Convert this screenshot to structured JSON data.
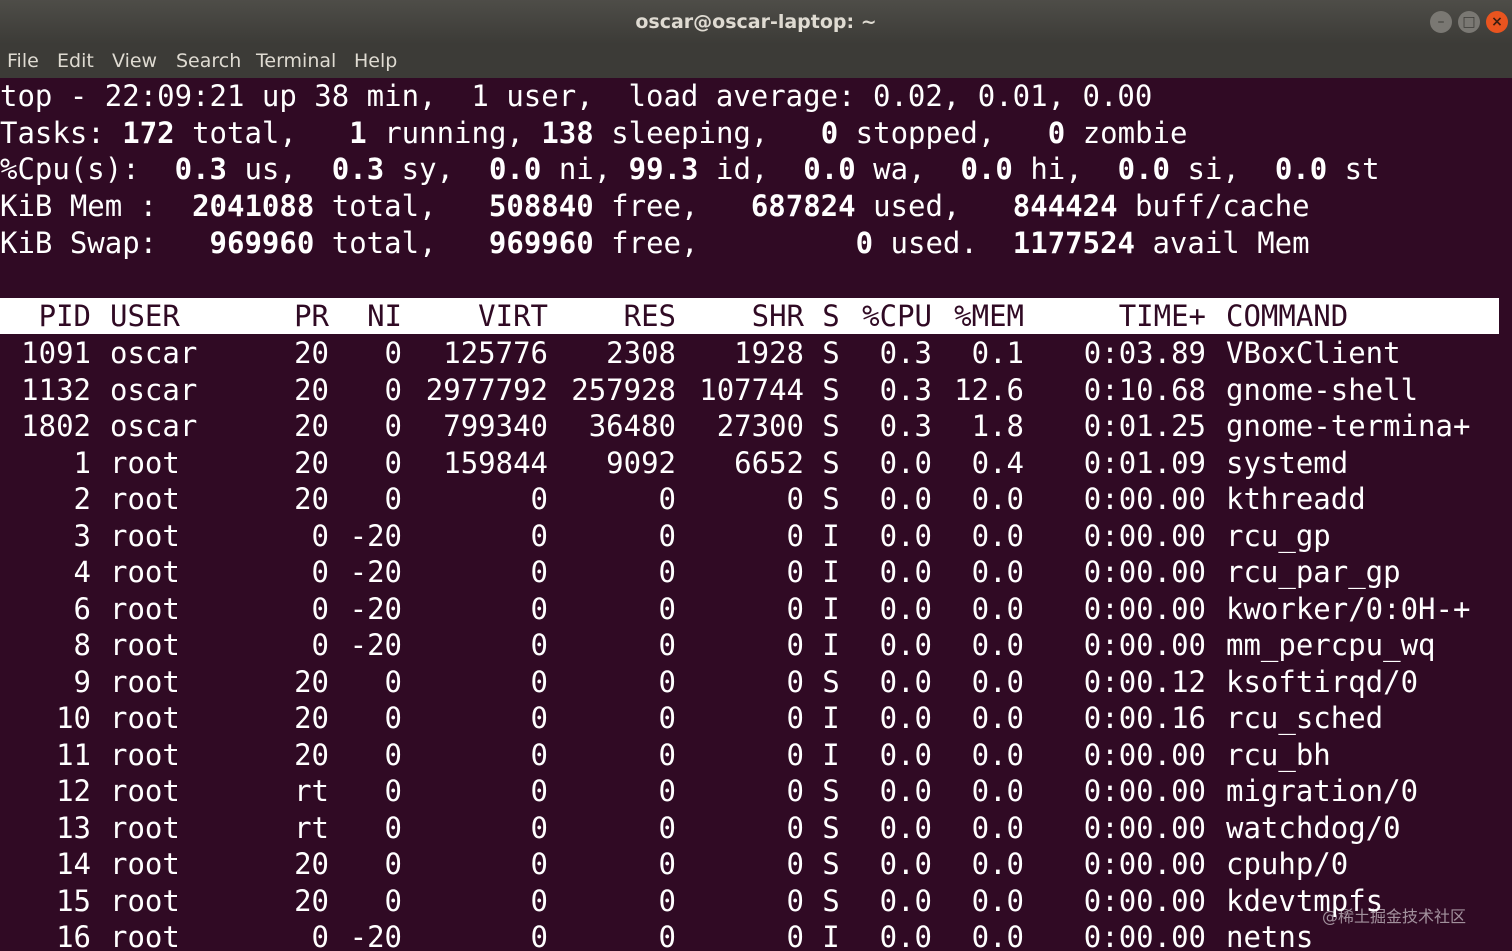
{
  "window": {
    "title": "oscar@oscar-laptop: ~"
  },
  "controls": {
    "minimize": "–",
    "maximize": "□",
    "close": "×"
  },
  "menu": [
    "File",
    "Edit",
    "View",
    "Search",
    "Terminal",
    "Help"
  ],
  "summary": {
    "line1": "top - 22:09:21 up 38 min,  1 user,  load average: 0.02, 0.01, 0.00",
    "tasks": {
      "label": "Tasks:",
      "total": "172",
      "total_label": "total,",
      "running": "1",
      "running_label": "running,",
      "sleeping": "138",
      "sleeping_label": "sleeping,",
      "stopped": "0",
      "stopped_label": "stopped,",
      "zombie": "0",
      "zombie_label": "zombie"
    },
    "cpu": {
      "label": "%Cpu(s):",
      "us": "0.3",
      "us_label": "us,",
      "sy": "0.3",
      "sy_label": "sy,",
      "ni": "0.0",
      "ni_label": "ni,",
      "id": "99.3",
      "id_label": "id,",
      "wa": "0.0",
      "wa_label": "wa,",
      "hi": "0.0",
      "hi_label": "hi,",
      "si": "0.0",
      "si_label": "si,",
      "st": "0.0",
      "st_label": "st"
    },
    "mem": {
      "label": "KiB Mem :",
      "total": "2041088",
      "total_label": "total,",
      "free": "508840",
      "free_label": "free,",
      "used": "687824",
      "used_label": "used,",
      "buff": "844424",
      "buff_label": "buff/cache"
    },
    "swap": {
      "label": "KiB Swap:",
      "total": "969960",
      "total_label": "total,",
      "free": "969960",
      "free_label": "free,",
      "used": "0",
      "used_label": "used.",
      "avail": "1177524",
      "avail_label": "avail Mem"
    }
  },
  "columns": [
    "PID",
    "USER",
    "PR",
    "NI",
    "VIRT",
    "RES",
    "SHR",
    "S",
    "%CPU",
    "%MEM",
    "TIME+",
    "COMMAND"
  ],
  "processes": [
    [
      "1091",
      "oscar",
      "20",
      "0",
      "125776",
      "2308",
      "1928",
      "S",
      "0.3",
      "0.1",
      "0:03.89",
      "VBoxClient"
    ],
    [
      "1132",
      "oscar",
      "20",
      "0",
      "2977792",
      "257928",
      "107744",
      "S",
      "0.3",
      "12.6",
      "0:10.68",
      "gnome-shell"
    ],
    [
      "1802",
      "oscar",
      "20",
      "0",
      "799340",
      "36480",
      "27300",
      "S",
      "0.3",
      "1.8",
      "0:01.25",
      "gnome-termina+"
    ],
    [
      "1",
      "root",
      "20",
      "0",
      "159844",
      "9092",
      "6652",
      "S",
      "0.0",
      "0.4",
      "0:01.09",
      "systemd"
    ],
    [
      "2",
      "root",
      "20",
      "0",
      "0",
      "0",
      "0",
      "S",
      "0.0",
      "0.0",
      "0:00.00",
      "kthreadd"
    ],
    [
      "3",
      "root",
      "0",
      "-20",
      "0",
      "0",
      "0",
      "I",
      "0.0",
      "0.0",
      "0:00.00",
      "rcu_gp"
    ],
    [
      "4",
      "root",
      "0",
      "-20",
      "0",
      "0",
      "0",
      "I",
      "0.0",
      "0.0",
      "0:00.00",
      "rcu_par_gp"
    ],
    [
      "6",
      "root",
      "0",
      "-20",
      "0",
      "0",
      "0",
      "I",
      "0.0",
      "0.0",
      "0:00.00",
      "kworker/0:0H-+"
    ],
    [
      "8",
      "root",
      "0",
      "-20",
      "0",
      "0",
      "0",
      "I",
      "0.0",
      "0.0",
      "0:00.00",
      "mm_percpu_wq"
    ],
    [
      "9",
      "root",
      "20",
      "0",
      "0",
      "0",
      "0",
      "S",
      "0.0",
      "0.0",
      "0:00.12",
      "ksoftirqd/0"
    ],
    [
      "10",
      "root",
      "20",
      "0",
      "0",
      "0",
      "0",
      "I",
      "0.0",
      "0.0",
      "0:00.16",
      "rcu_sched"
    ],
    [
      "11",
      "root",
      "20",
      "0",
      "0",
      "0",
      "0",
      "I",
      "0.0",
      "0.0",
      "0:00.00",
      "rcu_bh"
    ],
    [
      "12",
      "root",
      "rt",
      "0",
      "0",
      "0",
      "0",
      "S",
      "0.0",
      "0.0",
      "0:00.00",
      "migration/0"
    ],
    [
      "13",
      "root",
      "rt",
      "0",
      "0",
      "0",
      "0",
      "S",
      "0.0",
      "0.0",
      "0:00.00",
      "watchdog/0"
    ],
    [
      "14",
      "root",
      "20",
      "0",
      "0",
      "0",
      "0",
      "S",
      "0.0",
      "0.0",
      "0:00.00",
      "cpuhp/0"
    ],
    [
      "15",
      "root",
      "20",
      "0",
      "0",
      "0",
      "0",
      "S",
      "0.0",
      "0.0",
      "0:00.00",
      "kdevtmpfs"
    ],
    [
      "16",
      "root",
      "0",
      "-20",
      "0",
      "0",
      "0",
      "I",
      "0.0",
      "0.0",
      "0:00.00",
      "netns"
    ]
  ],
  "watermark": "@稀土掘金技术社区",
  "colors": {
    "terminal_bg": "#300a24",
    "text": "#ffffff",
    "titlebar": "#3c3b37",
    "close": "#e9541f"
  }
}
